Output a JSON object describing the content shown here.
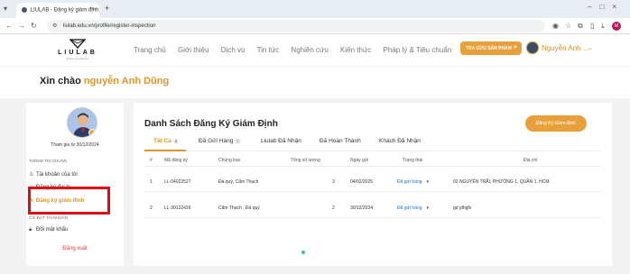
{
  "browser": {
    "tab_title": "LIULAB - Đăng ký giám định",
    "url": "liulab.edu.vn/profile/register-inspection"
  },
  "site": {
    "logo_text": "LIULAB",
    "logo_tagline": "truth in gemstones",
    "nav": [
      "Trang chủ",
      "Giới thiệu",
      "Dịch vụ",
      "Tin tức",
      "Nghiên cứu",
      "Kiến thức",
      "Pháp lý & Tiêu chuẩn"
    ],
    "search_button": "TRA CỨU SẢN PHẨM",
    "user_name": "Nguyễn Anh ..."
  },
  "greeting": {
    "prefix": "Xin chào",
    "name": "nguyễn Anh Dũng"
  },
  "sidebar": {
    "joined": "Tham gia từ 30/12/2024",
    "section_general": "THÔNG TIN CHUNG",
    "items": [
      {
        "label": "Tài khoản của tôi",
        "icon": "user-icon"
      },
      {
        "label": "Đăng ký đại lý",
        "icon": "star-icon"
      },
      {
        "label": "Đăng ký giám định",
        "icon": "edit-icon",
        "active": true
      }
    ],
    "section_account": "CÀI ĐẶT TÀI KHOẢN",
    "password_item": "Đổi mật khẩu",
    "logout": "Đăng xuất"
  },
  "main": {
    "title": "Danh Sách Đăng Ký Giám Định",
    "register_button": "Đăng Ký Giám Định",
    "tabs": [
      {
        "label": "Tất Cả",
        "count": "2",
        "active": true
      },
      {
        "label": "Đã Gửi Hàng",
        "count": "2"
      },
      {
        "label": "Liulab Đã Nhận",
        "count": ""
      },
      {
        "label": "Đã Hoàn Thành",
        "count": ""
      },
      {
        "label": "Khách Đã Nhận",
        "count": ""
      }
    ],
    "columns": [
      "#",
      "Mã đăng ký",
      "Chủng loại",
      "Tổng số lượng",
      "Ngày gửi",
      "Trạng thái",
      "Địa chỉ"
    ],
    "rows": [
      {
        "index": "1",
        "code": "LL-04022527",
        "type": "Đá quý, Cẩm Thạch",
        "qty": "3",
        "date": "04/02/2025",
        "status": "Đã gửi hàng",
        "address": "02 NGUYỄN TRÃI, PHƯỜNG 1, QUẬN 1, HCM"
      },
      {
        "index": "2",
        "code": "LL-30122426",
        "type": "Cẩm Thạch , Đá quý",
        "qty": "2",
        "date": "30/12/2024",
        "status": "Đã gửi hàng",
        "address": "gd jdhgfx"
      }
    ]
  },
  "colors": {
    "accent": "#e8a13a",
    "status_blue": "#1e73e8",
    "highlight_red": "#e50914"
  }
}
